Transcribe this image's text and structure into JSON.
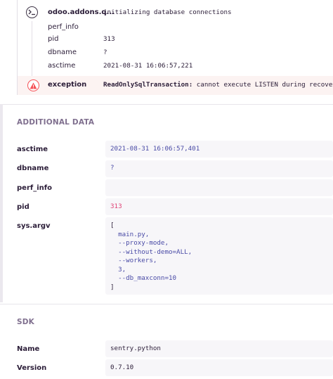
{
  "breadcrumb": {
    "category": "odoo.addons.q...",
    "message": "initializing database connections",
    "data": [
      {
        "key": "perf_info",
        "value": ""
      },
      {
        "key": "pid",
        "value": "313"
      },
      {
        "key": "dbname",
        "value": "?"
      },
      {
        "key": "asctime",
        "value": "2021-08-31 16:06:57,221"
      }
    ],
    "icon": "terminal-icon"
  },
  "exception": {
    "label": "exception",
    "type": "ReadOnlySqlTransaction:",
    "message": " cannot execute LISTEN during recovery",
    "icon": "warning-icon",
    "color": "#f55459"
  },
  "additional_data": {
    "title": "ADDITIONAL DATA",
    "rows": [
      {
        "key": "asctime",
        "value": "2021-08-31 16:06:57,401"
      },
      {
        "key": "dbname",
        "value": "?"
      },
      {
        "key": "perf_info",
        "value": ""
      },
      {
        "key": "pid",
        "value": "313"
      },
      {
        "key": "sys.argv",
        "value": ""
      }
    ],
    "argv": [
      "[",
      "  main.py,",
      "  --proxy-mode,",
      "  --without-demo=ALL,",
      "  --workers,",
      "  3,",
      "  --db_maxconn=10",
      "]"
    ]
  },
  "sdk": {
    "title": "SDK",
    "rows": [
      {
        "key": "Name",
        "value": "sentry.python"
      },
      {
        "key": "Version",
        "value": "0.7.10"
      }
    ]
  },
  "colors": {
    "string": "#4a4ba6",
    "number": "#e04477",
    "section_title": "#80708f"
  }
}
